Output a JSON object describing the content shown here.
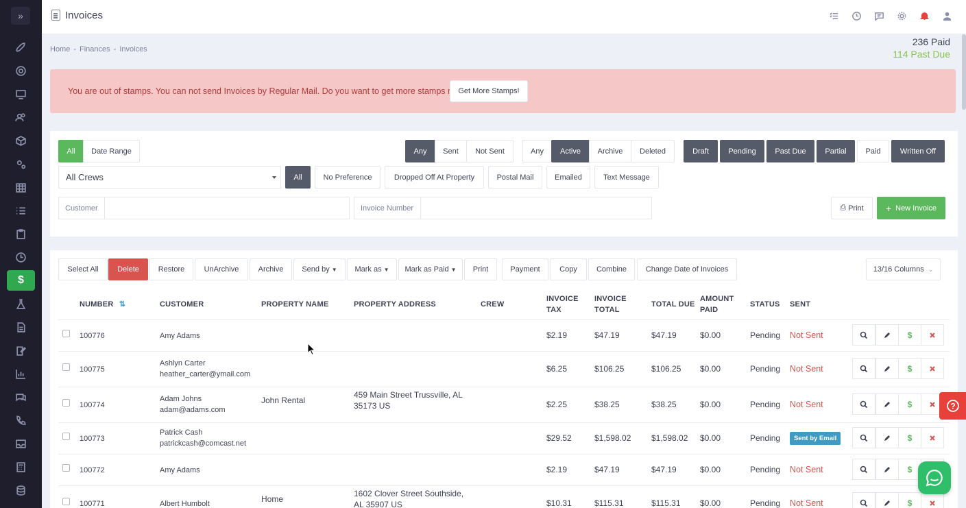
{
  "window": {
    "title": "Invoices"
  },
  "breadcrumb": [
    "Home",
    "-",
    "Finances",
    "-",
    "Invoices"
  ],
  "stats": {
    "paid": "236 Paid",
    "past_due": "114 Past Due"
  },
  "alert": {
    "message": "You are out of stamps. You can not send Invoices by Regular Mail. Do you want to get more stamps now?",
    "button": "Get More Stamps!"
  },
  "filters": {
    "date": {
      "all": "All",
      "range": "Date Range"
    },
    "sent": {
      "any": "Any",
      "sent": "Sent",
      "not_sent": "Not Sent"
    },
    "state": {
      "any": "Any",
      "active": "Active",
      "archive": "Archive",
      "deleted": "Deleted"
    },
    "status": {
      "draft": "Draft",
      "pending": "Pending",
      "past_due": "Past Due",
      "partial": "Partial",
      "paid": "Paid",
      "written_off": "Written Off"
    },
    "crews_select": "All Crews",
    "delivery": {
      "all": "All",
      "no_pref": "No Preference",
      "dropped": "Dropped Off At Property",
      "postal": "Postal Mail",
      "emailed": "Emailed",
      "text": "Text Message"
    },
    "customer_label": "Customer",
    "invoice_number_label": "Invoice Number",
    "print": "Print",
    "new_invoice": "New Invoice"
  },
  "toolbar": {
    "select_all": "Select All",
    "delete": "Delete",
    "restore": "Restore",
    "unarchive": "UnArchive",
    "archive": "Archive",
    "send_by": "Send by",
    "mark_as": "Mark as",
    "mark_as_paid": "Mark as Paid",
    "print": "Print",
    "payment": "Payment",
    "copy": "Copy",
    "combine": "Combine",
    "change_date": "Change Date of Invoices",
    "columns": "13/16 Columns"
  },
  "columns": {
    "number": "NUMBER",
    "customer": "CUSTOMER",
    "property_name": "PROPERTY NAME",
    "property_address": "PROPERTY ADDRESS",
    "crew": "CREW",
    "invoice_tax_1": "INVOICE",
    "invoice_tax_2": "TAX",
    "invoice_total_1": "INVOICE",
    "invoice_total_2": "TOTAL",
    "total_due": "TOTAL DUE",
    "amount_paid_1": "AMOUNT",
    "amount_paid_2": "PAID",
    "status": "STATUS",
    "sent": "SENT"
  },
  "rows": [
    {
      "number": "100776",
      "customer": "Amy Adams",
      "email": "",
      "property_name": "",
      "address_1": "",
      "address_2": "",
      "tax": "$2.19",
      "total": "$47.19",
      "due": "$47.19",
      "paid": "$0.00",
      "status": "Pending",
      "sent": "Not Sent"
    },
    {
      "number": "100775",
      "customer": "Ashlyn Carter",
      "email": "heather_carter@ymail.com",
      "property_name": "",
      "address_1": "",
      "address_2": "",
      "tax": "$6.25",
      "total": "$106.25",
      "due": "$106.25",
      "paid": "$0.00",
      "status": "Pending",
      "sent": "Not Sent"
    },
    {
      "number": "100774",
      "customer": "Adam Johns",
      "email": "adam@adams.com",
      "property_name": "John Rental",
      "address_1": "459 Main Street Trussville, AL",
      "address_2": "35173 US",
      "tax": "$2.25",
      "total": "$38.25",
      "due": "$38.25",
      "paid": "$0.00",
      "status": "Pending",
      "sent": "Not Sent"
    },
    {
      "number": "100773",
      "customer": "Patrick Cash",
      "email": "patrickcash@comcast.net",
      "property_name": "",
      "address_1": "",
      "address_2": "",
      "tax": "$29.52",
      "total": "$1,598.02",
      "due": "$1,598.02",
      "paid": "$0.00",
      "status": "Pending",
      "sent": "Sent by Email"
    },
    {
      "number": "100772",
      "customer": "Amy Adams",
      "email": "",
      "property_name": "",
      "address_1": "",
      "address_2": "",
      "tax": "$2.19",
      "total": "$47.19",
      "due": "$47.19",
      "paid": "$0.00",
      "status": "Pending",
      "sent": "Not Sent"
    },
    {
      "number": "100771",
      "customer": "Albert Humbolt",
      "email": "",
      "property_name": "Home",
      "address_1": "1602 Clover Street Southside,",
      "address_2": "AL 35907 US",
      "tax": "$10.31",
      "total": "$115.31",
      "due": "$115.31",
      "paid": "$0.00",
      "status": "Pending",
      "sent": "Not Sent"
    }
  ],
  "colors": {
    "sidebar": "#1e1e2d",
    "active_green": "#2fa84f",
    "alert_bg": "#f5c7c7",
    "alert_text": "#b33a3a",
    "past_due": "#8bc34a",
    "dark_btn": "#555b68"
  }
}
